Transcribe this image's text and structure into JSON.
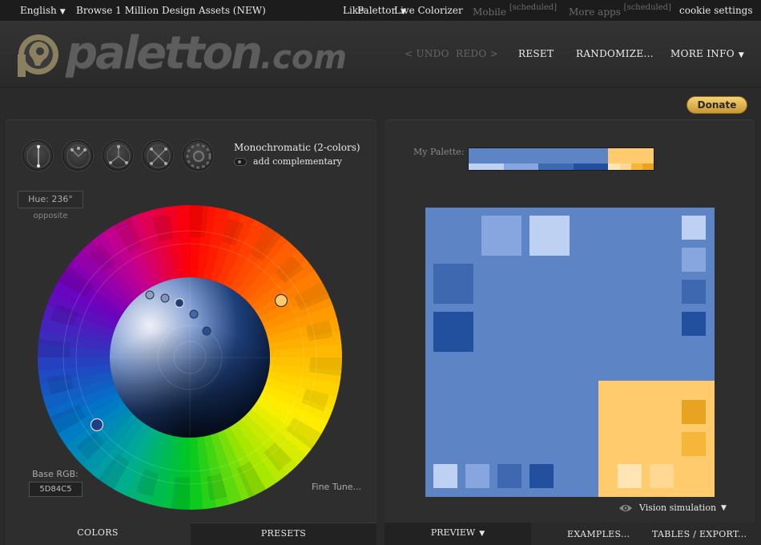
{
  "topbar": {
    "language": "English",
    "browse": "Browse 1 Million Design Assets (NEW)",
    "like": "Like",
    "paletton_menu": "Paletton",
    "live_colorizer": "Live Colorizer",
    "mobile": "Mobile",
    "mobile_badge": "[scheduled]",
    "more_apps": "More apps",
    "more_apps_badge": "[scheduled]",
    "cookie": "cookie settings"
  },
  "header": {
    "logo_main": "paletton",
    "logo_suffix": ".com",
    "undo": "< UNDO",
    "redo": "REDO >",
    "reset": "RESET",
    "randomize": "RANDOMIZE...",
    "more_info": "MORE INFO"
  },
  "donate": "Donate",
  "colors_panel": {
    "scheme_title": "Monochromatic (2-colors)",
    "add_complementary": "add complementary",
    "hue_label": "Hue: 236°",
    "hue_sub": "opposite",
    "base_rgb_label": "Base RGB:",
    "base_rgb_value": "5D84C5",
    "fine_tune": "Fine Tune...",
    "tab_colors": "COLORS",
    "tab_presets": "PRESETS"
  },
  "preview_panel": {
    "my_palette_label": "My Palette:",
    "vision_simulation": "Vision simulation",
    "tab_preview": "PREVIEW",
    "tab_examples": "EXAMPLES...",
    "tab_tables": "TABLES / EXPORT..."
  },
  "palette": {
    "base": "#5d84c5",
    "shades": [
      "#bed1f3",
      "#87a6e0",
      "#3e68b0",
      "#224f9e"
    ],
    "comp": "#ffcb6d",
    "comp_shades": [
      "#ffe5b3",
      "#ffd993",
      "#f5b63a",
      "#e8a321"
    ]
  }
}
